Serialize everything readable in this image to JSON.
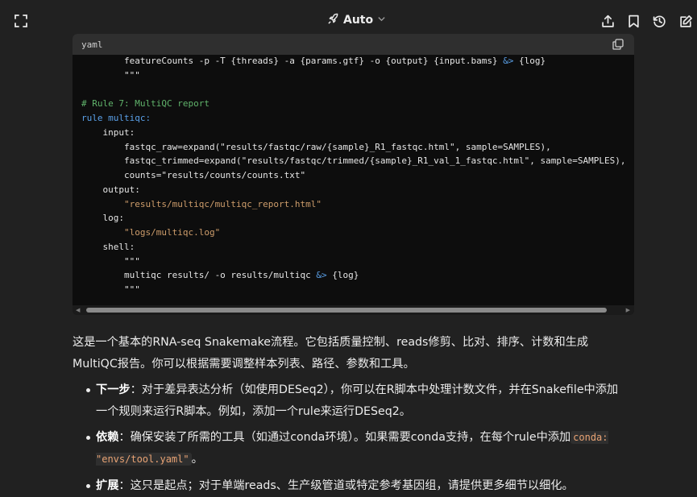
{
  "header": {
    "expand_icon": "fullscreen-icon",
    "model_label": "Auto",
    "model_icon": "rocket-icon",
    "actions": [
      "share-icon",
      "bookmark-icon",
      "history-icon",
      "edit-icon"
    ]
  },
  "code_block": {
    "language": "yaml",
    "lines": [
      [
        {
          "t": "        featureCounts -p -T {threads} -a {params.gtf} -o {output} {input.bams} ",
          "c": ""
        },
        {
          "t": "&>",
          "c": "op"
        },
        {
          "t": " {log}",
          "c": ""
        }
      ],
      [
        {
          "t": "        \"\"\"",
          "c": ""
        }
      ],
      [
        {
          "t": "",
          "c": ""
        }
      ],
      [
        {
          "t": "# Rule 7: MultiQC report",
          "c": "cm"
        }
      ],
      [
        {
          "t": "rule multiqc:",
          "c": "kw"
        }
      ],
      [
        {
          "t": "    input:",
          "c": ""
        }
      ],
      [
        {
          "t": "        fastqc_raw=expand(\"results/fastqc/raw/{sample}_R1_fastqc.html\", sample=SAMPLES),",
          "c": ""
        }
      ],
      [
        {
          "t": "        fastqc_trimmed=expand(\"results/fastqc/trimmed/{sample}_R1_val_1_fastqc.html\", sample=SAMPLES),",
          "c": ""
        }
      ],
      [
        {
          "t": "        counts=\"results/counts/counts.txt\"",
          "c": ""
        }
      ],
      [
        {
          "t": "    output:",
          "c": ""
        }
      ],
      [
        {
          "t": "        \"results/multiqc/multiqc_report.html\"",
          "c": "st"
        }
      ],
      [
        {
          "t": "    log:",
          "c": ""
        }
      ],
      [
        {
          "t": "        \"logs/multiqc.log\"",
          "c": "st"
        }
      ],
      [
        {
          "t": "    shell:",
          "c": ""
        }
      ],
      [
        {
          "t": "        \"\"\"",
          "c": ""
        }
      ],
      [
        {
          "t": "        multiqc results/ -o results/multiqc ",
          "c": ""
        },
        {
          "t": "&>",
          "c": "op"
        },
        {
          "t": " {log}",
          "c": ""
        }
      ],
      [
        {
          "t": "        \"\"\"",
          "c": ""
        }
      ]
    ]
  },
  "summary": "这是一个基本的RNA-seq Snakemake流程。它包括质量控制、reads修剪、比对、排序、计数和生成MultiQC报告。你可以根据需要调整样本列表、路径、参数和工具。",
  "bullets": [
    {
      "label": "下一步",
      "text": "：对于差异表达分析（如使用DESeq2），你可以在R脚本中处理计数文件，并在Snakefile中添加一个规则来运行R脚本。例如，添加一个rule来运行DESeq2。"
    },
    {
      "label": "依赖",
      "text": "：确保安装了所需的工具（如通过conda环境）。如果需要conda支持，在每个rule中添加",
      "code": "conda: \"envs/tool.yaml\"",
      "after": "。"
    },
    {
      "label": "扩展",
      "text": "：这只是起点；对于单端reads、生产级管道或特定参考基因组，请提供更多细节以细化。"
    }
  ],
  "colors": {
    "background": "#212121",
    "code_background": "#0d0d0d",
    "code_header": "#2f2f2f",
    "comment": "#60b36b",
    "keyword": "#5aa0e8",
    "string": "#ce9d6b",
    "inline_code": "#e9a374"
  }
}
